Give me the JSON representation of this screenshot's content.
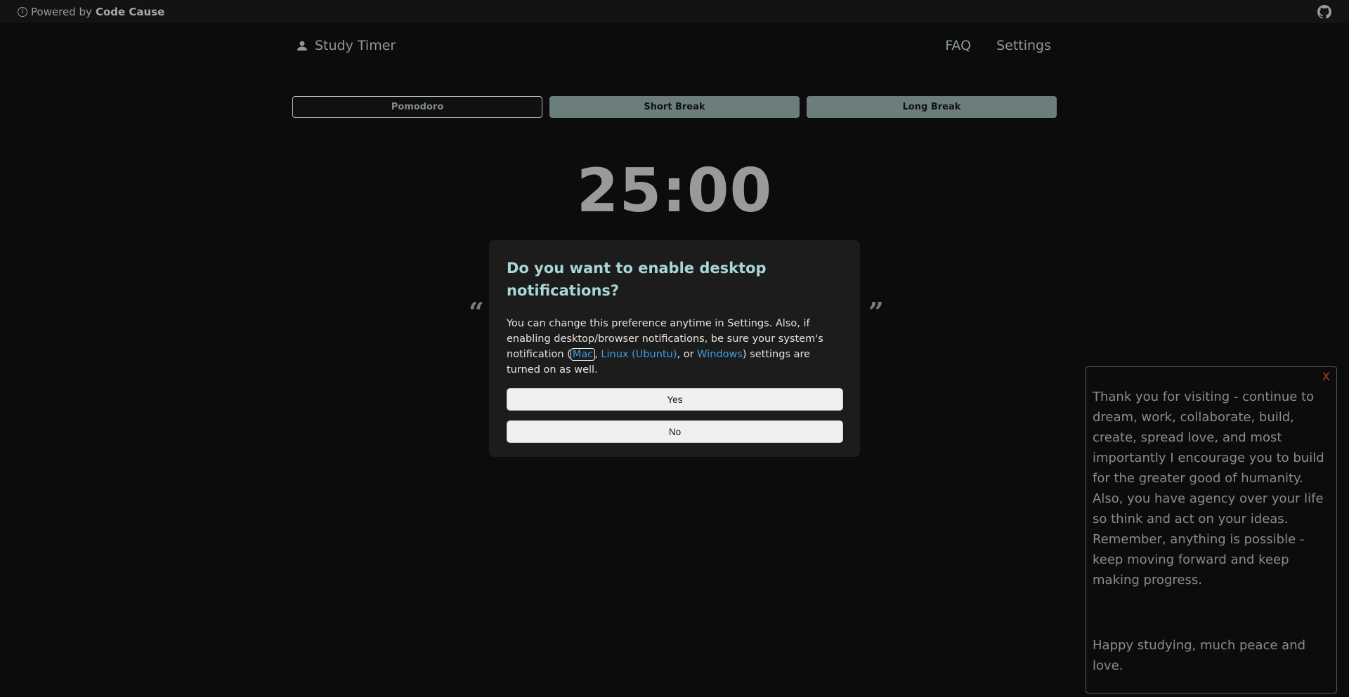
{
  "topbar": {
    "info_icon": "i",
    "powered_prefix": "Powered by",
    "brand": "Code Cause",
    "github_icon": "github-icon"
  },
  "nav": {
    "app_title": "Study Timer",
    "links": [
      "FAQ",
      "Settings"
    ]
  },
  "tabs": [
    {
      "label": "Pomodoro",
      "active": true
    },
    {
      "label": "Short Break",
      "active": false
    },
    {
      "label": "Long Break",
      "active": false
    }
  ],
  "timer": {
    "display": "25:00"
  },
  "quote": {
    "open_mark": "“",
    "close_mark": "”"
  },
  "modal": {
    "title": "Do you want to enable desktop notifications?",
    "text_1": "You can change this preference anytime in Settings. Also, if enabling desktop/browser notifications, be sure your system's notification (",
    "link_mac": "Mac",
    "text_2": ", ",
    "link_linux": "Linux (Ubuntu)",
    "text_3": ", or ",
    "link_windows": "Windows",
    "text_4": ") settings are turned on as well.",
    "yes_label": "Yes",
    "no_label": "No"
  },
  "side_panel": {
    "close_label": "X",
    "message": "Thank you for visiting - continue to dream, work, collaborate, build, create, spread love, and most importantly I encourage you to build for the greater good of humanity. Also, you have agency over your life so think and act on your ideas. Remember, anything is possible - keep moving forward and keep making progress.",
    "signoff": "Happy studying, much peace and love."
  },
  "colors": {
    "background": "#0c0c0c",
    "accent_teal": "#a9d7d5",
    "tab_inactive": "#6c7e7c",
    "link_blue": "#3d9fe0",
    "close_red": "#c0392b"
  }
}
